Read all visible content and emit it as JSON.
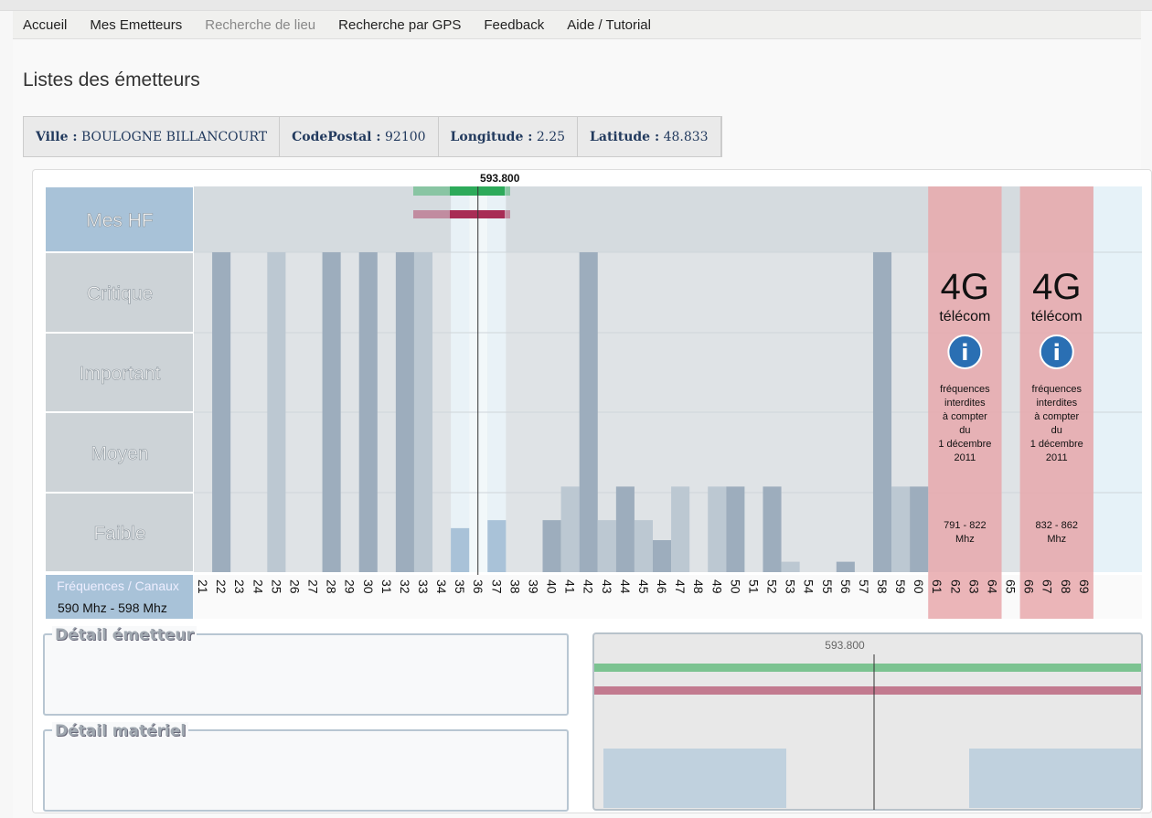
{
  "nav": {
    "items": [
      {
        "label": "Accueil"
      },
      {
        "label": "Mes Emetteurs"
      },
      {
        "label": "Recherche de lieu",
        "disabled": true
      },
      {
        "label": "Recherche par GPS"
      },
      {
        "label": "Feedback"
      },
      {
        "label": "Aide / Tutorial"
      }
    ]
  },
  "page_title": "Listes des émetteurs",
  "info": {
    "ville_label": "Ville :",
    "ville": "BOULOGNE BILLANCOURT",
    "cp_label": "CodePostal :",
    "cp": "92100",
    "lon_label": "Longitude :",
    "lon": "2.25",
    "lat_label": "Latitude :",
    "lat": "48.833"
  },
  "chart_data": {
    "type": "bar",
    "row_labels": [
      "Mes HF",
      "Critique",
      "Important",
      "Moyen",
      "Faible"
    ],
    "axis_label": "Fréquences / Canaux",
    "selected_range": "590 Mhz - 598 Mhz",
    "cursor_value": "593.800",
    "cursor_channel": 36,
    "cursor_position": 0.475,
    "selected_channels": [
      35,
      36,
      37
    ],
    "categories": [
      21,
      22,
      23,
      24,
      25,
      26,
      27,
      28,
      29,
      30,
      31,
      32,
      33,
      34,
      35,
      36,
      37,
      38,
      39,
      40,
      41,
      42,
      43,
      44,
      45,
      46,
      47,
      48,
      49,
      50,
      51,
      52,
      53,
      54,
      55,
      56,
      57,
      58,
      59,
      60,
      61,
      62,
      63,
      64,
      65,
      66,
      67,
      68,
      69
    ],
    "bars": [
      {
        "ch": 22,
        "level": 4,
        "shade": "dark"
      },
      {
        "ch": 25,
        "level": 4,
        "shade": "light"
      },
      {
        "ch": 28,
        "level": 4,
        "shade": "dark"
      },
      {
        "ch": 30,
        "level": 4,
        "shade": "dark"
      },
      {
        "ch": 32,
        "level": 4,
        "shade": "dark"
      },
      {
        "ch": 33,
        "level": 4,
        "shade": "light"
      },
      {
        "ch": 35,
        "level": 0.55,
        "shade": "blue"
      },
      {
        "ch": 37,
        "level": 0.65,
        "shade": "blue"
      },
      {
        "ch": 40,
        "level": 0.65,
        "shade": "dark"
      },
      {
        "ch": 41,
        "level": 1.07,
        "shade": "light"
      },
      {
        "ch": 42,
        "level": 4,
        "shade": "dark"
      },
      {
        "ch": 43,
        "level": 0.65,
        "shade": "light"
      },
      {
        "ch": 44,
        "level": 1.07,
        "shade": "dark"
      },
      {
        "ch": 45,
        "level": 0.65,
        "shade": "light"
      },
      {
        "ch": 46,
        "level": 0.4,
        "shade": "dark"
      },
      {
        "ch": 47,
        "level": 1.07,
        "shade": "light"
      },
      {
        "ch": 49,
        "level": 1.07,
        "shade": "light"
      },
      {
        "ch": 50,
        "level": 1.07,
        "shade": "dark"
      },
      {
        "ch": 52,
        "level": 1.07,
        "shade": "dark"
      },
      {
        "ch": 53,
        "level": 0.13,
        "shade": "light"
      },
      {
        "ch": 56,
        "level": 0.13,
        "shade": "dark"
      },
      {
        "ch": 58,
        "level": 4,
        "shade": "dark"
      },
      {
        "ch": 59,
        "level": 1.07,
        "shade": "light"
      },
      {
        "ch": 60,
        "level": 1.07,
        "shade": "dark"
      }
    ],
    "bands": [
      {
        "from": 61,
        "to": 64,
        "title": "4G",
        "sub": "télécom",
        "note": [
          "fréquences",
          "interdites",
          "à compter",
          "du",
          "1 décembre",
          "2011"
        ],
        "range": "791 - 822",
        "unit": "Mhz"
      },
      {
        "from": 66,
        "to": 69,
        "title": "4G",
        "sub": "télécom",
        "note": [
          "fréquences",
          "interdites",
          "à compter",
          "du",
          "1 décembre",
          "2011"
        ],
        "range": "832 - 862",
        "unit": "Mhz"
      }
    ],
    "colors": {
      "dark": "#9dadbd",
      "light": "#bcc8d2",
      "blue": "#a9c2d8",
      "green": "#2daa5a",
      "red": "#a82c55",
      "band": "#e8a8ac"
    }
  },
  "details": {
    "emetteur": "Détail émetteur",
    "materiel": "Détail matériel"
  },
  "zoom_panel": {
    "cursor_value": "593.800"
  }
}
